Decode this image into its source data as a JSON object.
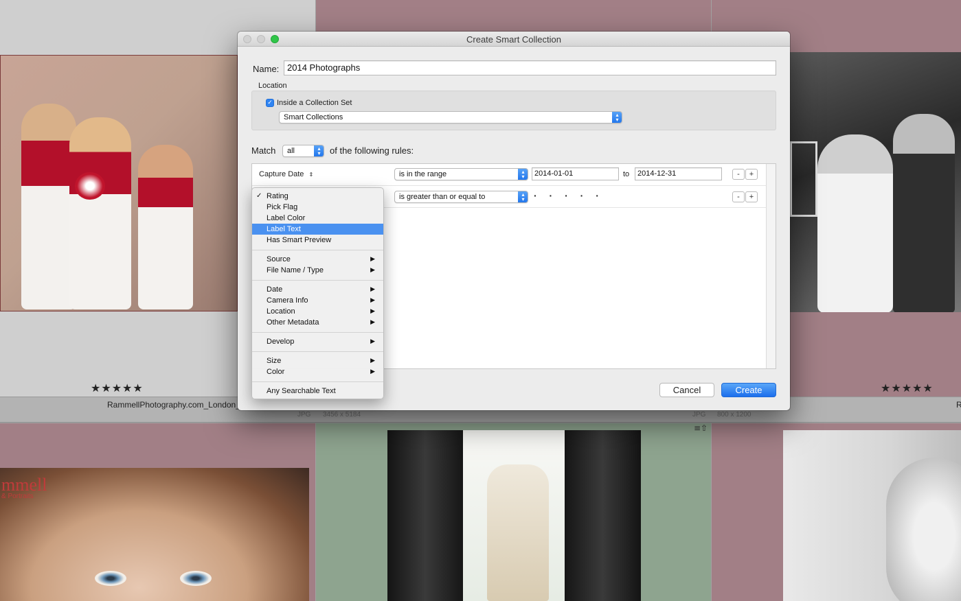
{
  "background": {
    "stars_left": "★★★★★",
    "stars_right": "★★★★★",
    "caption_left": "RammellPhotography.com_London_",
    "caption_right": "R",
    "meta1_type": "JPG",
    "meta1_dims": "3456 x 5184",
    "meta2_type": "JPG",
    "meta2_dims": "800 x 1200",
    "watermark": "mmell",
    "watermark_sub": "& Portraits",
    "cell_icon": "≡⇧"
  },
  "dialog": {
    "title": "Create Smart Collection",
    "name_label": "Name:",
    "name_value": "2014 Photographs",
    "location_label": "Location",
    "inside_set_label": "Inside a Collection Set",
    "inside_set_checked": true,
    "collection_set": "Smart Collections",
    "match_label": "Match",
    "match_value": "all",
    "match_suffix": "of the following rules:",
    "rules": [
      {
        "field": "Capture Date",
        "operator": "is in the range",
        "from": "2014-01-01",
        "to_label": "to",
        "to": "2014-12-31"
      },
      {
        "operator": "is greater than or equal to",
        "value": "· · · · ·"
      }
    ],
    "minus": "-",
    "plus": "+",
    "cancel": "Cancel",
    "create": "Create"
  },
  "menu": {
    "items": [
      {
        "label": "Rating",
        "checked": true
      },
      {
        "label": "Pick Flag"
      },
      {
        "label": "Label Color"
      },
      {
        "label": "Label Text",
        "selected": true
      },
      {
        "label": "Has Smart Preview"
      },
      {
        "label": "Source",
        "submenu": true
      },
      {
        "label": "File Name / Type",
        "submenu": true
      },
      {
        "label": "Date",
        "submenu": true
      },
      {
        "label": "Camera Info",
        "submenu": true
      },
      {
        "label": "Location",
        "submenu": true
      },
      {
        "label": "Other Metadata",
        "submenu": true
      },
      {
        "label": "Develop",
        "submenu": true
      },
      {
        "label": "Size",
        "submenu": true
      },
      {
        "label": "Color",
        "submenu": true
      },
      {
        "label": "Any Searchable Text"
      }
    ],
    "check_glyph": "✓",
    "arrow_glyph": "▶"
  },
  "colors": {
    "accent": "#2f84f2",
    "menu_highlight": "#4a91f0",
    "cell_pink": "#a27f86",
    "cell_green": "#8ea48f"
  }
}
